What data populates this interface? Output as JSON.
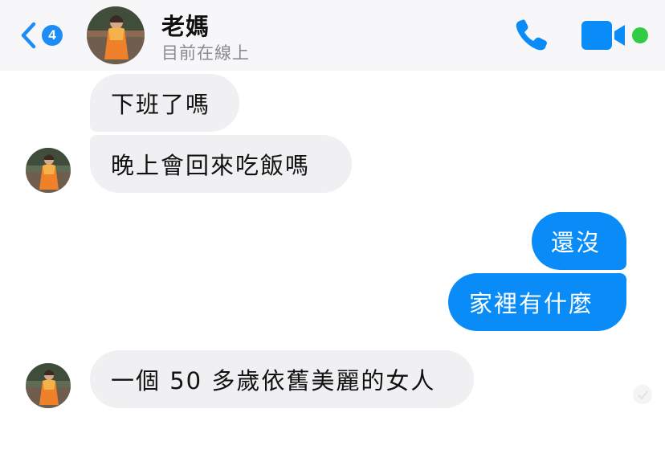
{
  "header": {
    "unread_count": "4",
    "contact_name": "老媽",
    "status": "目前在線上",
    "colors": {
      "accent": "#0a8cf8",
      "online": "#31cc46"
    },
    "icons": [
      "back-chevron-icon",
      "phone-icon",
      "video-camera-icon"
    ]
  },
  "messages": [
    {
      "sender": "contact",
      "text": "下班了嗎"
    },
    {
      "sender": "contact",
      "text": "晚上會回來吃飯嗎"
    },
    {
      "sender": "me",
      "text": "還沒"
    },
    {
      "sender": "me",
      "text": "家裡有什麼"
    },
    {
      "sender": "contact",
      "text": "一個 50 多歲依舊美麗的女人"
    }
  ]
}
